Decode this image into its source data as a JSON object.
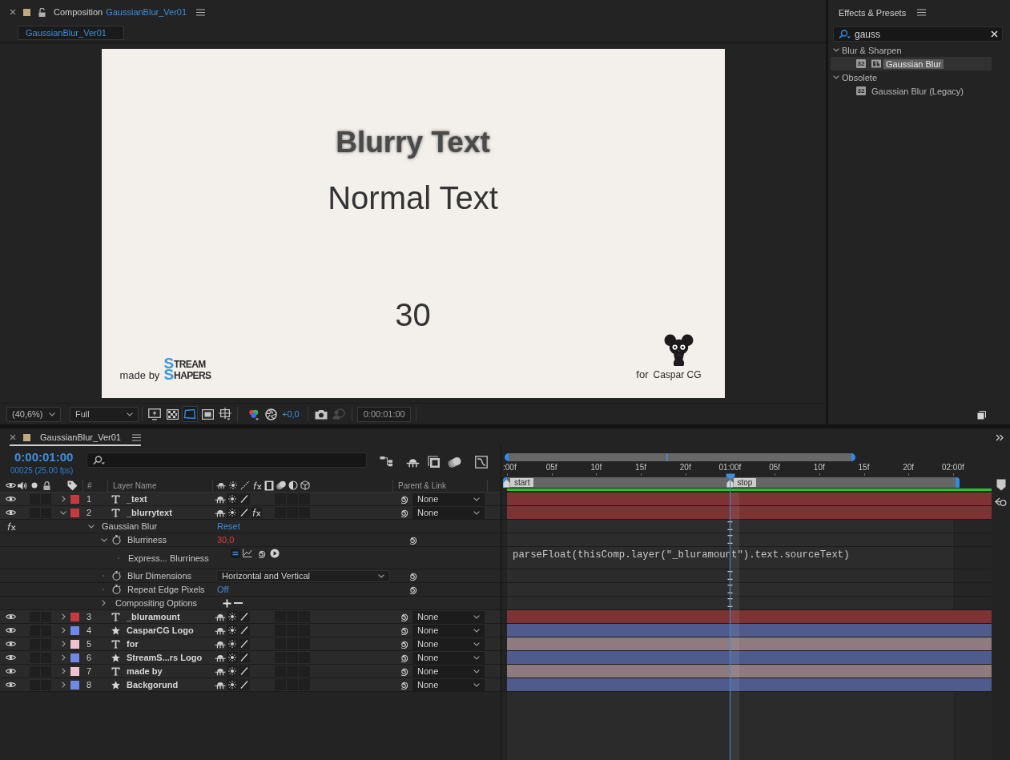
{
  "composition_panel": {
    "title": "Composition",
    "comp_name": "GaussianBlur_Ver01",
    "locked": false,
    "tabs": [
      {
        "label": "GaussianBlur_Ver01",
        "selected": true
      }
    ],
    "canvas": {
      "lines": [
        {
          "kind": "blurred",
          "text": "Blurry Text"
        },
        {
          "kind": "normal",
          "text": "Normal Text"
        },
        {
          "kind": "number",
          "text": "30"
        }
      ],
      "credit_left": {
        "label": "made by",
        "logo": [
          "STREAM",
          "SHAPERS"
        ]
      },
      "credit_right": {
        "label": "for",
        "name": "Caspar CG"
      }
    },
    "toolbar": {
      "zoom": "(40,6%)",
      "resolution": "Full",
      "view_toggles": [
        {
          "selected": false
        },
        {
          "selected": false
        },
        {
          "selected": true
        },
        {
          "selected": false
        },
        {
          "selected": false
        }
      ],
      "exposure": "+0,0",
      "show_snapshot": {
        "disabled": true
      },
      "time": "0:00:01:00"
    }
  },
  "effects_panel": {
    "title": "Effects & Presets",
    "search": {
      "value": "gauss"
    },
    "categories": [
      {
        "label": "Blur & Sharpen",
        "expanded": true,
        "selected": false,
        "children": [
          {
            "label": "Gaussian Blur",
            "selected": true,
            "badge": "32",
            "gpu": true
          }
        ]
      },
      {
        "label": "Obsolete",
        "expanded": true,
        "selected": false,
        "children": [
          {
            "label": "Gaussian Blur (Legacy)",
            "selected": false,
            "badge": "32",
            "gpu": false
          }
        ]
      }
    ]
  },
  "timeline_panel": {
    "tab": {
      "label": "GaussianBlur_Ver01",
      "selected": true
    },
    "timecode": "0:00:01:00",
    "frame_info": "00025 (25.00 fps)",
    "columns": {
      "number": "#",
      "layer_name": "Layer Name",
      "parent": "Parent & Link"
    },
    "ruler": [
      {
        "label": ":00f",
        "marker": "start",
        "current": false
      },
      {
        "label": "05f",
        "current": false
      },
      {
        "label": "10f",
        "current": false
      },
      {
        "label": "15f",
        "current": false
      },
      {
        "label": "20f",
        "current": false
      },
      {
        "label": "01:00f",
        "marker": "stop",
        "current": true
      },
      {
        "label": "05f",
        "current": false
      },
      {
        "label": "10f",
        "current": false
      },
      {
        "label": "15f",
        "current": false
      },
      {
        "label": "20f",
        "current": false
      },
      {
        "label": "02:00f",
        "current": false
      }
    ],
    "layers": [
      {
        "number": "1",
        "kind": "text",
        "name": "_text",
        "color": "#c8393b",
        "visible": true,
        "expanded": false,
        "has_fx": false,
        "parent": "None"
      },
      {
        "number": "2",
        "kind": "text",
        "name": "_blurrytext",
        "color": "#c8393b",
        "visible": true,
        "expanded": true,
        "has_fx": true,
        "parent": "None",
        "effects": [
          {
            "name": "Gaussian Blur",
            "enabled": true,
            "expanded": true,
            "action": "Reset",
            "properties": [
              {
                "kind": "number",
                "name": "Blurriness",
                "value": "30,0",
                "expression_driven": true,
                "expanded": true,
                "expression": {
                  "label": "Express... Blurriness",
                  "enabled": true,
                  "code": "parseFloat(thisComp.layer(\"_bluramount\").text.sourceText)"
                }
              },
              {
                "kind": "dropdown",
                "name": "Blur Dimensions",
                "value": "Horizontal and Vertical",
                "expression_driven": false
              },
              {
                "kind": "toggle",
                "name": "Repeat Edge Pixels",
                "value": "Off",
                "expression_driven": false
              },
              {
                "kind": "group",
                "name": "Compositing Options",
                "expanded": false
              }
            ]
          }
        ]
      },
      {
        "number": "3",
        "kind": "text",
        "name": "_bluramount",
        "color": "#c8393b",
        "visible": true,
        "expanded": false,
        "has_fx": false,
        "parent": "None"
      },
      {
        "number": "4",
        "kind": "shape",
        "name": "CasparCG Logo",
        "color": "#7088e6",
        "visible": true,
        "expanded": false,
        "has_fx": false,
        "parent": "None"
      },
      {
        "number": "5",
        "kind": "text",
        "name": "for",
        "color": "#ecc3ce",
        "visible": true,
        "expanded": false,
        "has_fx": false,
        "parent": "None"
      },
      {
        "number": "6",
        "kind": "shape",
        "name": "StreamS...rs Logo",
        "color": "#7088e6",
        "visible": true,
        "expanded": false,
        "has_fx": false,
        "parent": "None"
      },
      {
        "number": "7",
        "kind": "text",
        "name": "made by",
        "color": "#ecc3ce",
        "visible": true,
        "expanded": false,
        "has_fx": false,
        "parent": "None"
      },
      {
        "number": "8",
        "kind": "shape",
        "name": "Backgorund",
        "color": "#7088e6",
        "visible": true,
        "expanded": false,
        "has_fx": false,
        "parent": "None"
      }
    ]
  }
}
